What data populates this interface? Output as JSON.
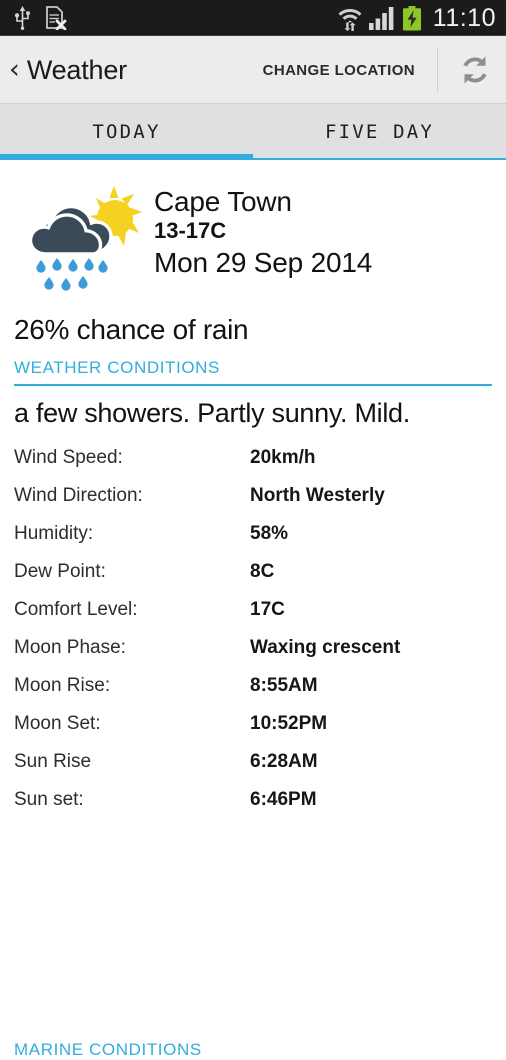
{
  "status_bar": {
    "icons_left": [
      "usb-icon",
      "no-sim-card-icon"
    ],
    "icons_right": [
      "wifi-transfer-icon",
      "cellular-signal-icon",
      "battery-charging-icon"
    ],
    "time": "11:10",
    "background_color": "#1b1b1b",
    "battery_color": "#8BC727"
  },
  "action_bar": {
    "back_chevron": "‹",
    "title": "Weather",
    "change_location_label": "CHANGE LOCATION",
    "refresh_icon": "refresh-icon",
    "background_color": "#ececed"
  },
  "tabs": {
    "accent_color": "#32ADDE",
    "items": [
      {
        "label": "TODAY",
        "active": true
      },
      {
        "label": "FIVE DAY",
        "active": false
      }
    ]
  },
  "today": {
    "weather_icon": "sun-behind-rain-cloud-icon",
    "location": "Cape Town",
    "temperature_range": "13-17C",
    "date": "Mon 29 Sep 2014",
    "rain_chance": "26% chance of rain",
    "weather_conditions_header": "WEATHER CONDITIONS",
    "conditions_description": "a few showers. Partly sunny. Mild.",
    "details": [
      {
        "label": "Wind Speed:",
        "value": "20km/h"
      },
      {
        "label": "Wind Direction:",
        "value": "North Westerly"
      },
      {
        "label": "Humidity:",
        "value": "58%"
      },
      {
        "label": "Dew Point:",
        "value": "8C"
      },
      {
        "label": "Comfort Level:",
        "value": "17C"
      },
      {
        "label": "Moon Phase:",
        "value": "Waxing crescent"
      },
      {
        "label": "Moon Rise:",
        "value": "8:55AM"
      },
      {
        "label": "Moon Set:",
        "value": "10:52PM"
      },
      {
        "label": "Sun Rise",
        "value": "6:28AM"
      },
      {
        "label": "Sun set:",
        "value": "6:46PM"
      }
    ],
    "marine_conditions_header": "MARINE CONDITIONS"
  },
  "palette": {
    "accent": "#32ADDE",
    "cloud_dark": "#3A4A58",
    "sun_yellow": "#F5D220",
    "raindrop_blue": "#3D9BD9",
    "text_primary": "#121212"
  }
}
